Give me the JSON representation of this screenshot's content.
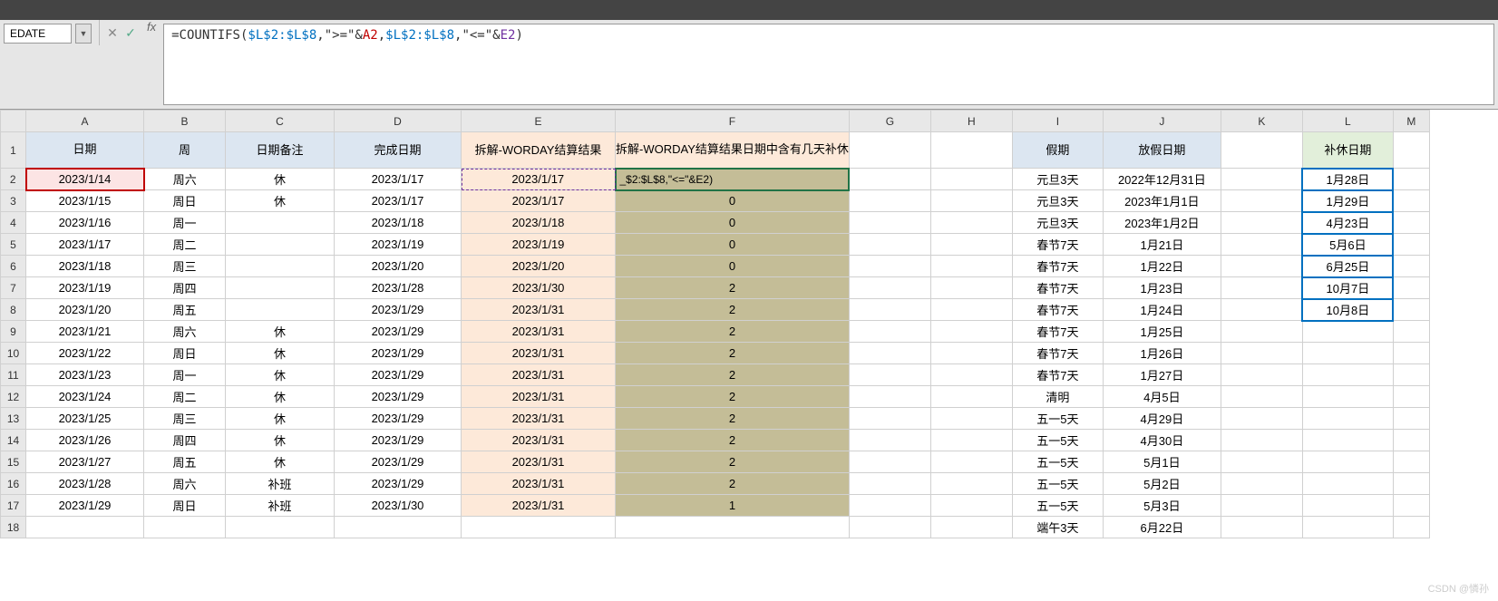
{
  "nameBox": "EDATE",
  "formula": {
    "prefix": "=COUNTIFS(",
    "ref1": "$L$2:$L$8",
    "s1": ",\">=\"&",
    "ref2": "A2",
    "s2": ",",
    "ref3": "$L$2:$L$8",
    "s3": ",\"<=\"&",
    "ref4": "E2",
    "suffix": ")"
  },
  "cols": [
    "A",
    "B",
    "C",
    "D",
    "E",
    "F",
    "G",
    "H",
    "I",
    "J",
    "K",
    "L",
    "M"
  ],
  "headers": {
    "A": "日期",
    "B": "周",
    "C": "日期备注",
    "D": "完成日期",
    "E": "拆解-WORDAY结算结果",
    "F": "拆解-WORDAY结算结果日期中含有几天补休",
    "I": "假期",
    "J": "放假日期",
    "L": "补休日期"
  },
  "editCellText": "_$2:$L$8,\"<=\"&E2)",
  "rows": [
    {
      "r": 2,
      "A": "2023/1/14",
      "B": "周六",
      "C": "休",
      "D": "2023/1/17",
      "E": "2023/1/17",
      "F": "",
      "I": "元旦3天",
      "J": "2022年12月31日",
      "L": "1月28日"
    },
    {
      "r": 3,
      "A": "2023/1/15",
      "B": "周日",
      "C": "休",
      "D": "2023/1/17",
      "E": "2023/1/17",
      "F": "0",
      "I": "元旦3天",
      "J": "2023年1月1日",
      "L": "1月29日"
    },
    {
      "r": 4,
      "A": "2023/1/16",
      "B": "周一",
      "C": "",
      "D": "2023/1/18",
      "E": "2023/1/18",
      "F": "0",
      "I": "元旦3天",
      "J": "2023年1月2日",
      "L": "4月23日"
    },
    {
      "r": 5,
      "A": "2023/1/17",
      "B": "周二",
      "C": "",
      "D": "2023/1/19",
      "E": "2023/1/19",
      "F": "0",
      "I": "春节7天",
      "J": "1月21日",
      "L": "5月6日"
    },
    {
      "r": 6,
      "A": "2023/1/18",
      "B": "周三",
      "C": "",
      "D": "2023/1/20",
      "E": "2023/1/20",
      "F": "0",
      "I": "春节7天",
      "J": "1月22日",
      "L": "6月25日"
    },
    {
      "r": 7,
      "A": "2023/1/19",
      "B": "周四",
      "C": "",
      "D": "2023/1/28",
      "E": "2023/1/30",
      "F": "2",
      "I": "春节7天",
      "J": "1月23日",
      "L": "10月7日"
    },
    {
      "r": 8,
      "A": "2023/1/20",
      "B": "周五",
      "C": "",
      "D": "2023/1/29",
      "E": "2023/1/31",
      "F": "2",
      "I": "春节7天",
      "J": "1月24日",
      "L": "10月8日"
    },
    {
      "r": 9,
      "A": "2023/1/21",
      "B": "周六",
      "C": "休",
      "D": "2023/1/29",
      "E": "2023/1/31",
      "F": "2",
      "I": "春节7天",
      "J": "1月25日",
      "L": ""
    },
    {
      "r": 10,
      "A": "2023/1/22",
      "B": "周日",
      "C": "休",
      "D": "2023/1/29",
      "E": "2023/1/31",
      "F": "2",
      "I": "春节7天",
      "J": "1月26日",
      "L": ""
    },
    {
      "r": 11,
      "A": "2023/1/23",
      "B": "周一",
      "C": "休",
      "D": "2023/1/29",
      "E": "2023/1/31",
      "F": "2",
      "I": "春节7天",
      "J": "1月27日",
      "L": ""
    },
    {
      "r": 12,
      "A": "2023/1/24",
      "B": "周二",
      "C": "休",
      "D": "2023/1/29",
      "E": "2023/1/31",
      "F": "2",
      "I": "清明",
      "J": "4月5日",
      "L": ""
    },
    {
      "r": 13,
      "A": "2023/1/25",
      "B": "周三",
      "C": "休",
      "D": "2023/1/29",
      "E": "2023/1/31",
      "F": "2",
      "I": "五一5天",
      "J": "4月29日",
      "L": ""
    },
    {
      "r": 14,
      "A": "2023/1/26",
      "B": "周四",
      "C": "休",
      "D": "2023/1/29",
      "E": "2023/1/31",
      "F": "2",
      "I": "五一5天",
      "J": "4月30日",
      "L": ""
    },
    {
      "r": 15,
      "A": "2023/1/27",
      "B": "周五",
      "C": "休",
      "D": "2023/1/29",
      "E": "2023/1/31",
      "F": "2",
      "I": "五一5天",
      "J": "5月1日",
      "L": ""
    },
    {
      "r": 16,
      "A": "2023/1/28",
      "B": "周六",
      "C": "补班",
      "D": "2023/1/29",
      "E": "2023/1/31",
      "F": "2",
      "I": "五一5天",
      "J": "5月2日",
      "L": ""
    },
    {
      "r": 17,
      "A": "2023/1/29",
      "B": "周日",
      "C": "补班",
      "D": "2023/1/30",
      "E": "2023/1/31",
      "F": "1",
      "I": "五一5天",
      "J": "5月3日",
      "L": ""
    },
    {
      "r": 18,
      "A": "",
      "B": "",
      "C": "",
      "D": "",
      "E": "",
      "F": "",
      "I": "端午3天",
      "J": "6月22日",
      "L": ""
    }
  ],
  "watermark": "CSDN @憐孙"
}
